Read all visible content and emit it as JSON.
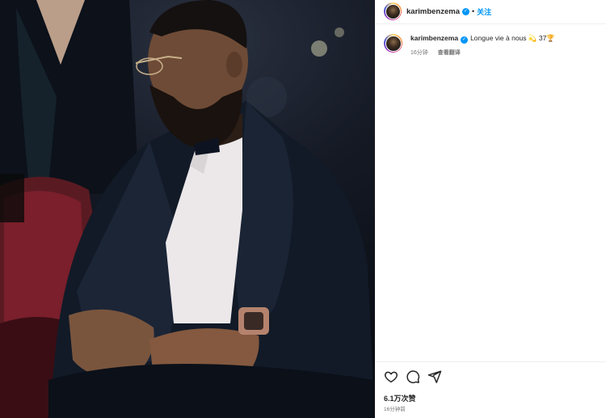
{
  "post": {
    "photo_alt": "photo",
    "author": {
      "username": "karimbenzema",
      "verified_mark": "✓",
      "follow_label": "关注",
      "separator": "•"
    },
    "caption": {
      "username": "karimbenzema",
      "text": "Longue vie à nous 💫 37🏆",
      "age": "16分钟",
      "translate_label": "查看翻译"
    },
    "actions": {
      "like_icon": "heart-icon",
      "comment_icon": "comment-icon",
      "share_icon": "send-icon"
    },
    "likes_label": "6.1万次赞",
    "timestamp": "16分钟前"
  },
  "colors": {
    "accent": "#0095f6",
    "text": "#262626",
    "muted": "#737373",
    "divider": "#efefef"
  }
}
